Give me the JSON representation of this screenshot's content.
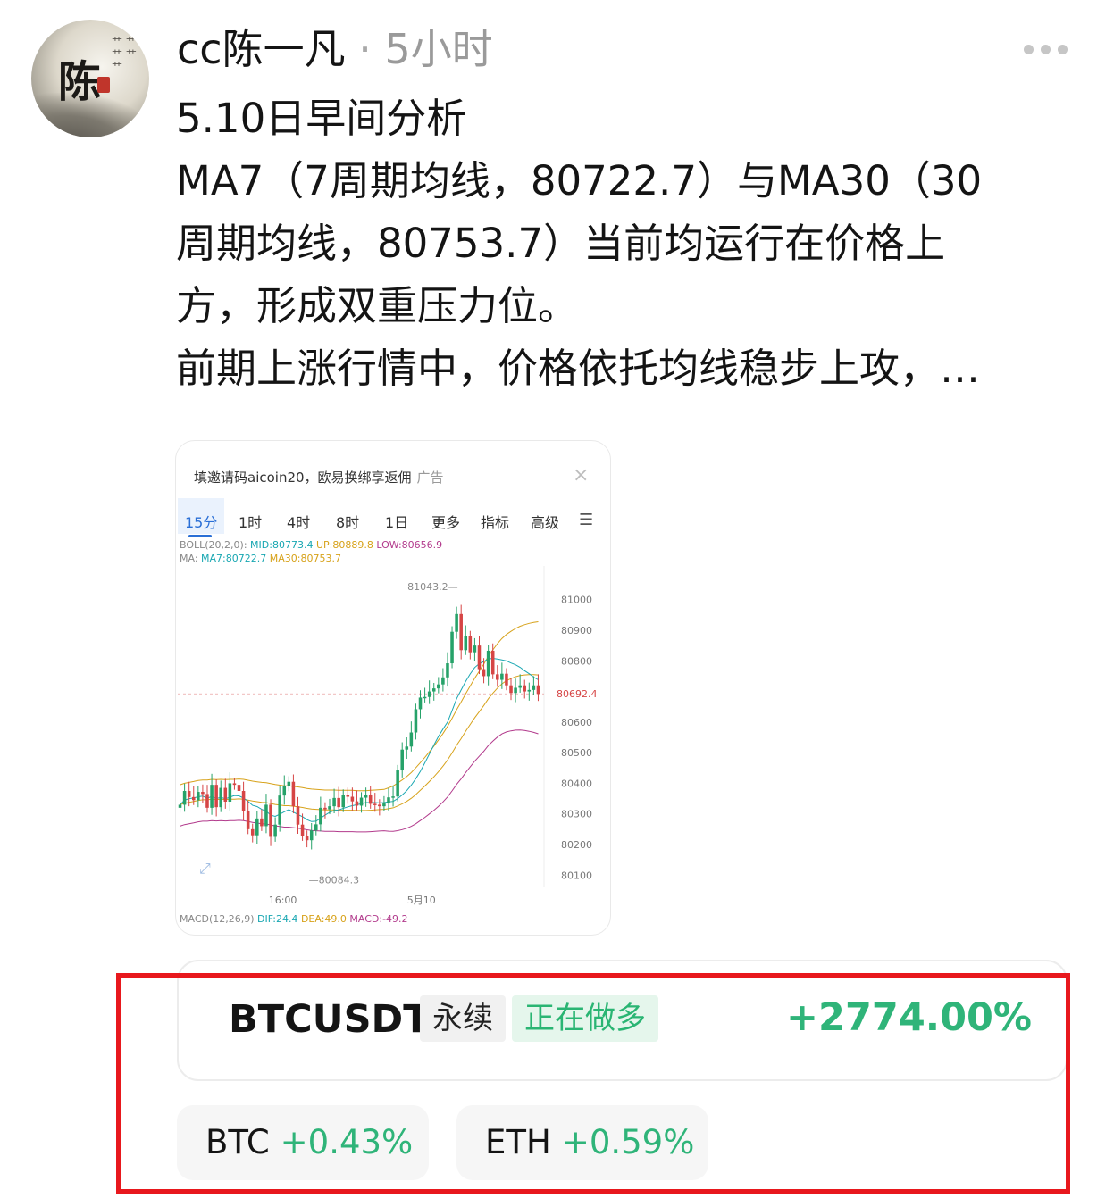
{
  "header": {
    "author": "cc陈一凡",
    "separator": "·",
    "time": "5小时"
  },
  "post": {
    "lines": [
      "5.10日早间分析",
      "MA7（7周期均线，80722.7）与MA30（30",
      "周期均线，80753.7）当前均运行在价格上",
      "方，形成双重压力位。",
      "前期上涨行情中，价格依托均线稳步上攻，…"
    ]
  },
  "chart_card": {
    "ad_text": "填邀请码aicoin20，欧易换绑享返佣",
    "ad_tag": "广告",
    "tabs": [
      "15分",
      "1时",
      "4时",
      "8时",
      "1日",
      "更多",
      "指标",
      "高级"
    ],
    "active_tab": "15分",
    "boll": {
      "label": "BOLL(20,2,0):",
      "mid": "MID:80773.4",
      "up": "UP:80889.8",
      "low": "LOW:80656.9"
    },
    "ma": {
      "label": "MA:",
      "ma7": "MA7:80722.7",
      "ma30": "MA30:80753.7"
    },
    "macd": {
      "label": "MACD(12,26,9)",
      "dif": "DIF:24.4",
      "dea": "DEA:49.0",
      "macd": "MACD:-49.2"
    },
    "colors": {
      "up": "#26a269",
      "down": "#d64545",
      "mid": "#19a7b2",
      "upper": "#d7a21a",
      "lower": "#b23a8c"
    }
  },
  "chart_data": {
    "type": "candlestick",
    "yticks": [
      81000,
      80900,
      80800,
      80692.4,
      80600,
      80500,
      80400,
      80300,
      80200,
      80100
    ],
    "ylim": [
      80060,
      81110
    ],
    "current_price": 80692.4,
    "high_label": "81043.2",
    "low_label": "80084.3",
    "xticks": [
      "16:00",
      "5月10"
    ],
    "close": [
      80330,
      80375,
      80355,
      80345,
      80372,
      80365,
      80320,
      80395,
      80322,
      80385,
      80340,
      80400,
      80395,
      80375,
      80308,
      80250,
      80230,
      80285,
      80260,
      80330,
      80225,
      80265,
      80360,
      80390,
      80405,
      80325,
      80265,
      80228,
      80214,
      80246,
      80266,
      80320,
      80315,
      80325,
      80352,
      80322,
      80362,
      80356,
      80341,
      80327,
      80353,
      80362,
      80333,
      80330,
      80325,
      80334,
      80354,
      80357,
      80442,
      80510,
      80520,
      80566,
      80642,
      80680,
      80682,
      80700,
      80710,
      80723,
      80746,
      80792,
      80895,
      80953,
      80835,
      80880,
      80828,
      80850,
      80773,
      80750,
      80833,
      80756,
      80738,
      80758,
      80720,
      80695,
      80712,
      80720,
      80700,
      80705,
      80720,
      80692
    ],
    "series": [
      {
        "name": "MA7",
        "values": [
          80330,
          80345,
          80350,
          80352,
          80356,
          80358,
          80351,
          80357,
          80350,
          80354,
          80349,
          80355,
          80360,
          80359,
          80352,
          80341,
          80328,
          80324,
          80315,
          80309,
          80296,
          80292,
          80299,
          80307,
          80314,
          80306,
          80298,
          80291,
          80281,
          80275,
          80276,
          80286,
          80296,
          80305,
          80311,
          80313,
          80318,
          80323,
          80327,
          80330,
          80333,
          80337,
          80337,
          80337,
          80336,
          80337,
          80339,
          80341,
          80350,
          80362,
          80376,
          80394,
          80415,
          80439,
          80467,
          80496,
          80525,
          80553,
          80577,
          80600,
          80637,
          80676,
          80705,
          80733,
          80757,
          80778,
          80791,
          80798,
          80806,
          80808,
          80806,
          80803,
          80800,
          80793,
          80787,
          80779,
          80768,
          80758,
          80747,
          80738
        ]
      },
      {
        "name": "MA30",
        "values": [
          80330,
          80335,
          80338,
          80341,
          80344,
          80346,
          80346,
          80348,
          80347,
          80348,
          80347,
          80348,
          80348,
          80349,
          80348,
          80345,
          80342,
          80340,
          80338,
          80337,
          80334,
          80331,
          80329,
          80327,
          80327,
          80325,
          80323,
          80321,
          80318,
          80316,
          80315,
          80314,
          80313,
          80313,
          80313,
          80312,
          80312,
          80312,
          80312,
          80311,
          80311,
          80311,
          80312,
          80313,
          80314,
          80315,
          80317,
          80320,
          80326,
          80333,
          80341,
          80351,
          80363,
          80377,
          80391,
          80406,
          80421,
          80438,
          80456,
          80476,
          80499,
          80524,
          80546,
          80570,
          80592,
          80614,
          80634,
          80654,
          80676,
          80694,
          80711,
          80725,
          80735,
          80742,
          80748,
          80752,
          80754,
          80755,
          80755,
          80754
        ]
      }
    ]
  },
  "position": {
    "symbol": "BTCUSDT",
    "contract_type": "永续",
    "status": "正在做多",
    "pnl": "+2774.00%"
  },
  "tickers": [
    {
      "symbol": "BTC",
      "change": "+0.43%"
    },
    {
      "symbol": "ETH",
      "change": "+0.59%"
    }
  ]
}
